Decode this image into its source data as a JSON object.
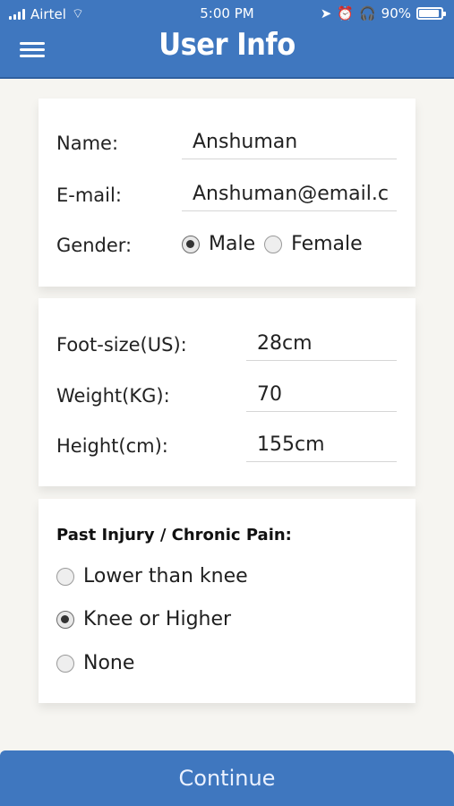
{
  "status": {
    "carrier": "Airtel",
    "time": "5:00 PM",
    "battery_percent": "90%"
  },
  "header": {
    "title": "User Info",
    "menu_icon": "hamburger-icon",
    "color": "#3f77bf"
  },
  "card_personal": {
    "name_label": "Name:",
    "name_value": "Anshuman",
    "email_label": "E-mail:",
    "email_value": "Anshuman@email.c",
    "gender_label": "Gender:",
    "gender_options": [
      "Male",
      "Female"
    ],
    "gender_selected": "Male"
  },
  "card_body": {
    "foot_label": "Foot-size(US):",
    "foot_value": "28cm",
    "weight_label": "Weight(KG):",
    "weight_value": "70",
    "height_label": "Height(cm):",
    "height_value": "155cm"
  },
  "card_injury": {
    "title": "Past Injury / Chronic Pain:",
    "options": [
      "Lower than knee",
      "Knee or Higher",
      "None"
    ],
    "selected": "Knee or Higher"
  },
  "footer": {
    "continue_label": "Continue"
  }
}
